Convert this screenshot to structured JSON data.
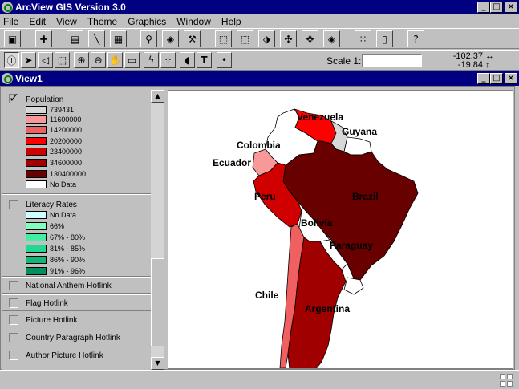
{
  "app": {
    "title": "ArcView GIS Version 3.0"
  },
  "menu": [
    "File",
    "Edit",
    "View",
    "Theme",
    "Graphics",
    "Window",
    "Help"
  ],
  "toolbar": {
    "scale_label": "Scale 1:",
    "scale_value": "",
    "coord_x": "-102.37",
    "coord_y": "-19.84",
    "coord_arrows_x": "↔",
    "coord_arrows_y": "↕"
  },
  "view": {
    "title": "View1"
  },
  "toc": {
    "population": {
      "title": "Population",
      "checked": true,
      "classes": [
        {
          "label": "739431",
          "color": "#d8d8d8"
        },
        {
          "label": "11600000",
          "color": "#f89898"
        },
        {
          "label": "14200000",
          "color": "#f06060"
        },
        {
          "label": "20200000",
          "color": "#ff0000"
        },
        {
          "label": "23400000",
          "color": "#d00000"
        },
        {
          "label": "34600000",
          "color": "#a00000"
        },
        {
          "label": "130400000",
          "color": "#680000"
        },
        {
          "label": "No Data",
          "color": "#ffffff"
        }
      ]
    },
    "literacy": {
      "title": "Literacy Rates",
      "checked": false,
      "classes": [
        {
          "label": "No Data",
          "color": "#ccffff"
        },
        {
          "label": "66%",
          "color": "#80ffc0"
        },
        {
          "label": "67% - 80%",
          "color": "#40f0a0"
        },
        {
          "label": "81% - 85%",
          "color": "#20d890"
        },
        {
          "label": "86% - 90%",
          "color": "#10b878"
        },
        {
          "label": "91% - 96%",
          "color": "#009060"
        }
      ]
    },
    "hotlinks": [
      {
        "title": "National Anthem Hotlink"
      },
      {
        "title": "Flag Hotlink"
      },
      {
        "title": "Picture Hotlink"
      },
      {
        "title": "Country Paragraph Hotlink"
      },
      {
        "title": "Author Picture Hotlink"
      }
    ]
  },
  "map": {
    "labels": {
      "venezuela": "Venezuela",
      "guyana": "Guyana",
      "colombia": "Colombia",
      "ecuador": "Ecuador",
      "brazil": "Brazil",
      "peru": "Peru",
      "bolivia": "Bolivia",
      "paraguay": "Paraguay",
      "chile": "Chile",
      "argentina": "Argentina"
    }
  }
}
